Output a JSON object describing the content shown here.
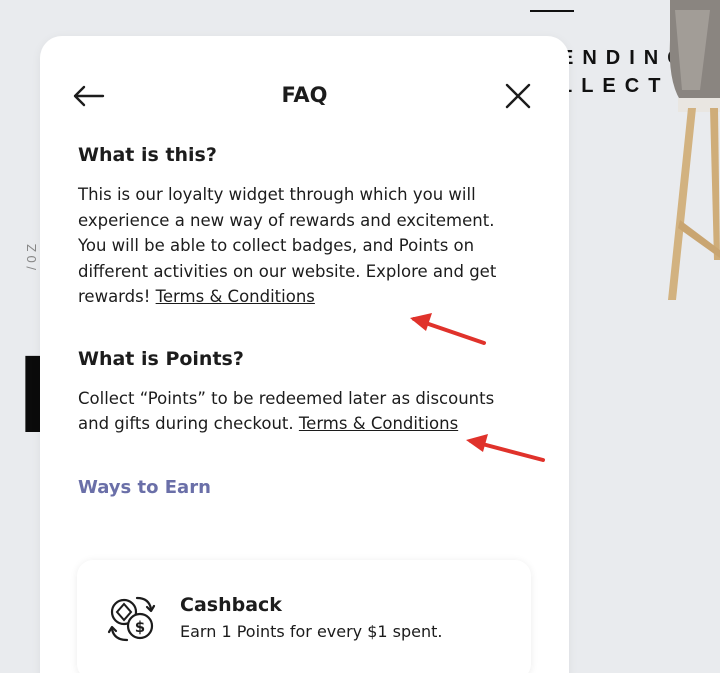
{
  "background": {
    "heading_line1": "ENDING",
    "heading_line2": "LLECT",
    "vertical_text": "/ 0 Z",
    "big_glyph": "I"
  },
  "modal": {
    "title": "FAQ",
    "back_icon": "arrow-left-icon",
    "close_icon": "close-icon",
    "faq": [
      {
        "question": "What is this?",
        "answer": "This is our loyalty widget through which you will experience a new way of rewards and excitement. You will be able to collect badges, and Points on different activities on our website. Explore and get rewards! ",
        "link": "Terms & Conditions"
      },
      {
        "question": "What is Points?",
        "answer": "Collect “Points” to be redeemed later as discounts and gifts during checkout. ",
        "link": "Terms & Conditions"
      }
    ],
    "ways_to_earn": {
      "heading": "Ways to Earn",
      "items": [
        {
          "icon": "cashback-coins-icon",
          "title": "Cashback",
          "description": "Earn 1 Points for every $1 spent."
        }
      ]
    }
  },
  "colors": {
    "accent": "#6a6fa8",
    "annotation_arrow": "#e0322b",
    "page_background": "#e9ebee",
    "text": "#1c1c1c"
  }
}
